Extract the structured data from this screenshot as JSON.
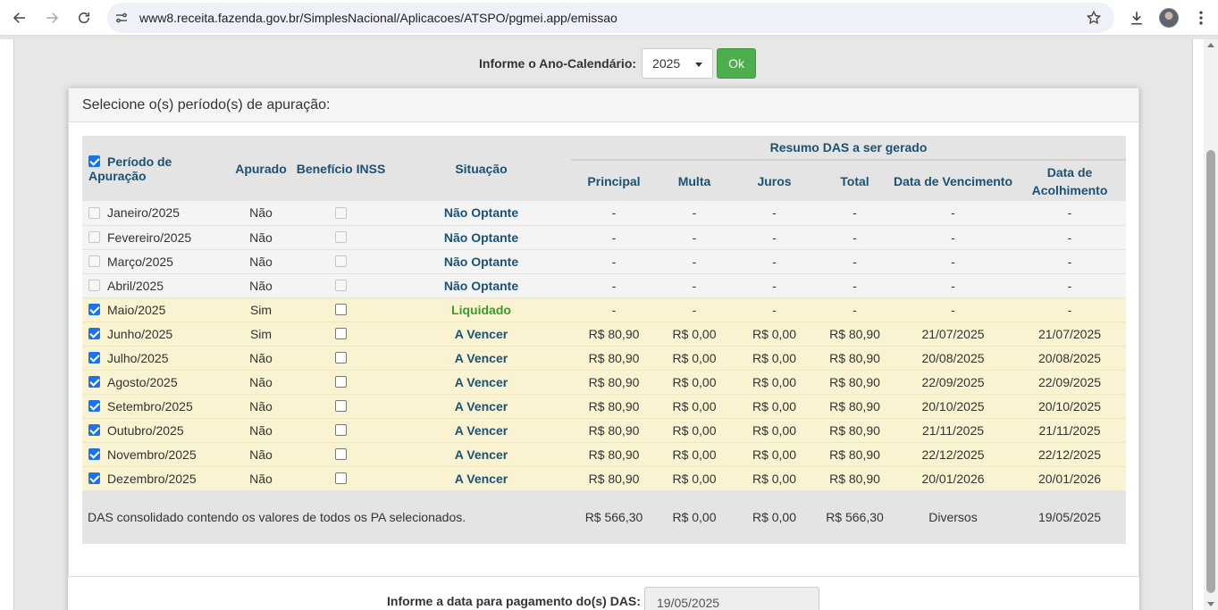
{
  "browser": {
    "url": "www8.receita.fazenda.gov.br/SimplesNacional/Aplicacoes/ATSPO/pgmei.app/emissao"
  },
  "year_selector": {
    "label": "Informe o Ano-Calendário:",
    "selected": "2025",
    "ok_label": "Ok"
  },
  "panel": {
    "title": "Selecione o(s) período(s) de apuração:"
  },
  "table": {
    "headers": {
      "periodo": "Período de Apuração",
      "apurado": "Apurado",
      "beneficio": "Benefício INSS",
      "situacao": "Situação",
      "resumo": "Resumo DAS a ser gerado",
      "principal": "Principal",
      "multa": "Multa",
      "juros": "Juros",
      "total": "Total",
      "vencimento": "Data de Vencimento",
      "acolhimento": "Data de Acolhimento"
    },
    "rows": [
      {
        "periodo": "Janeiro/2025",
        "apurado": "Não",
        "situacao": "Não Optante",
        "principal": "-",
        "multa": "-",
        "juros": "-",
        "total": "-",
        "vencimento": "-",
        "acolhimento": "-",
        "style": "gray",
        "checked": false,
        "enabled": false,
        "status": "normal"
      },
      {
        "periodo": "Fevereiro/2025",
        "apurado": "Não",
        "situacao": "Não Optante",
        "principal": "-",
        "multa": "-",
        "juros": "-",
        "total": "-",
        "vencimento": "-",
        "acolhimento": "-",
        "style": "gray",
        "checked": false,
        "enabled": false,
        "status": "normal"
      },
      {
        "periodo": "Março/2025",
        "apurado": "Não",
        "situacao": "Não Optante",
        "principal": "-",
        "multa": "-",
        "juros": "-",
        "total": "-",
        "vencimento": "-",
        "acolhimento": "-",
        "style": "gray",
        "checked": false,
        "enabled": false,
        "status": "normal"
      },
      {
        "periodo": "Abril/2025",
        "apurado": "Não",
        "situacao": "Não Optante",
        "principal": "-",
        "multa": "-",
        "juros": "-",
        "total": "-",
        "vencimento": "-",
        "acolhimento": "-",
        "style": "gray",
        "checked": false,
        "enabled": false,
        "status": "normal"
      },
      {
        "periodo": "Maio/2025",
        "apurado": "Sim",
        "situacao": "Liquidado",
        "principal": "-",
        "multa": "-",
        "juros": "-",
        "total": "-",
        "vencimento": "-",
        "acolhimento": "-",
        "style": "yellow",
        "checked": true,
        "enabled": true,
        "status": "liq"
      },
      {
        "periodo": "Junho/2025",
        "apurado": "Sim",
        "situacao": "A Vencer",
        "principal": "R$ 80,90",
        "multa": "R$ 0,00",
        "juros": "R$ 0,00",
        "total": "R$ 80,90",
        "vencimento": "21/07/2025",
        "acolhimento": "21/07/2025",
        "style": "yellow",
        "checked": true,
        "enabled": true,
        "status": "normal"
      },
      {
        "periodo": "Julho/2025",
        "apurado": "Não",
        "situacao": "A Vencer",
        "principal": "R$ 80,90",
        "multa": "R$ 0,00",
        "juros": "R$ 0,00",
        "total": "R$ 80,90",
        "vencimento": "20/08/2025",
        "acolhimento": "20/08/2025",
        "style": "yellow",
        "checked": true,
        "enabled": true,
        "status": "normal"
      },
      {
        "periodo": "Agosto/2025",
        "apurado": "Não",
        "situacao": "A Vencer",
        "principal": "R$ 80,90",
        "multa": "R$ 0,00",
        "juros": "R$ 0,00",
        "total": "R$ 80,90",
        "vencimento": "22/09/2025",
        "acolhimento": "22/09/2025",
        "style": "yellow",
        "checked": true,
        "enabled": true,
        "status": "normal"
      },
      {
        "periodo": "Setembro/2025",
        "apurado": "Não",
        "situacao": "A Vencer",
        "principal": "R$ 80,90",
        "multa": "R$ 0,00",
        "juros": "R$ 0,00",
        "total": "R$ 80,90",
        "vencimento": "20/10/2025",
        "acolhimento": "20/10/2025",
        "style": "yellow",
        "checked": true,
        "enabled": true,
        "status": "normal"
      },
      {
        "periodo": "Outubro/2025",
        "apurado": "Não",
        "situacao": "A Vencer",
        "principal": "R$ 80,90",
        "multa": "R$ 0,00",
        "juros": "R$ 0,00",
        "total": "R$ 80,90",
        "vencimento": "21/11/2025",
        "acolhimento": "21/11/2025",
        "style": "yellow",
        "checked": true,
        "enabled": true,
        "status": "normal"
      },
      {
        "periodo": "Novembro/2025",
        "apurado": "Não",
        "situacao": "A Vencer",
        "principal": "R$ 80,90",
        "multa": "R$ 0,00",
        "juros": "R$ 0,00",
        "total": "R$ 80,90",
        "vencimento": "22/12/2025",
        "acolhimento": "22/12/2025",
        "style": "yellow",
        "checked": true,
        "enabled": true,
        "status": "normal"
      },
      {
        "periodo": "Dezembro/2025",
        "apurado": "Não",
        "situacao": "A Vencer",
        "principal": "R$ 80,90",
        "multa": "R$ 0,00",
        "juros": "R$ 0,00",
        "total": "R$ 80,90",
        "vencimento": "20/01/2026",
        "acolhimento": "20/01/2026",
        "style": "yellow",
        "checked": true,
        "enabled": true,
        "status": "normal"
      }
    ],
    "footer": {
      "text": "DAS consolidado contendo os valores de todos os PA selecionados.",
      "principal": "R$ 566,30",
      "multa": "R$ 0,00",
      "juros": "R$ 0,00",
      "total": "R$ 566,30",
      "vencimento": "Diversos",
      "acolhimento": "19/05/2025"
    }
  },
  "payment_date": {
    "label": "Informe a data para pagamento do(s) DAS:",
    "value": "19/05/2025"
  },
  "colors": {
    "header_text": "#1a5276",
    "liquidado": "#3a9a2a",
    "ok_button": "#4cae4c",
    "row_highlight": "#f9f3d1",
    "checkbox_checked": "#1a73e8"
  }
}
